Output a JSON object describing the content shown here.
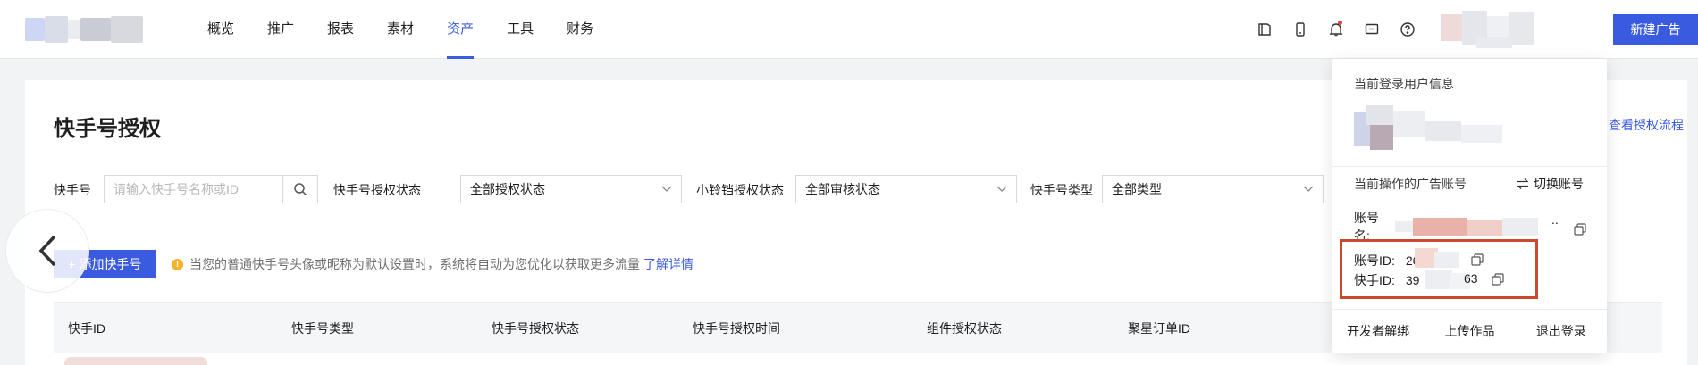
{
  "nav": {
    "items": [
      {
        "label": "概览",
        "active": false
      },
      {
        "label": "推广",
        "active": false
      },
      {
        "label": "报表",
        "active": false
      },
      {
        "label": "素材",
        "active": false
      },
      {
        "label": "资产",
        "active": true
      },
      {
        "label": "工具",
        "active": false
      },
      {
        "label": "财务",
        "active": false
      }
    ],
    "new_ad_label": "新建广告",
    "accent": "#3a5be0"
  },
  "page": {
    "title": "快手号授权",
    "view_flow_link": "查看授权流程"
  },
  "filters": {
    "account_label": "快手号",
    "account_placeholder": "请输入快手号名称或ID",
    "auth_status_label": "快手号授权状态",
    "auth_status_value": "全部授权状态",
    "bell_status_label": "小铃铛授权状态",
    "bell_status_value": "全部审核状态",
    "type_label": "快手号类型",
    "type_value": "全部类型"
  },
  "actions": {
    "add_label": "+ 添加快手号",
    "tip_text": "当您的普通快手号头像或昵称为默认设置时，系统将自动为您优化以获取更多流量",
    "tip_link": "了解详情"
  },
  "table": {
    "columns": [
      "快手ID",
      "快手号类型",
      "快手号授权状态",
      "快手号授权时间",
      "组件授权状态",
      "聚星订单ID"
    ]
  },
  "user_panel": {
    "current_user_title": "当前登录用户信息",
    "current_account_title": "当前操作的广告账号",
    "switch_label": "切换账号",
    "account_name_label": "账号名:",
    "ellipsis": "..",
    "account_id_label": "账号ID:",
    "account_id_value": "26",
    "kuaishou_id_label": "快手ID:",
    "kuaishou_id_prefix": "39",
    "kuaishou_id_suffix": "63",
    "bottom_links": [
      "开发者解绑",
      "上传作品",
      "退出登录"
    ],
    "highlight_color": "#c94a2e"
  }
}
